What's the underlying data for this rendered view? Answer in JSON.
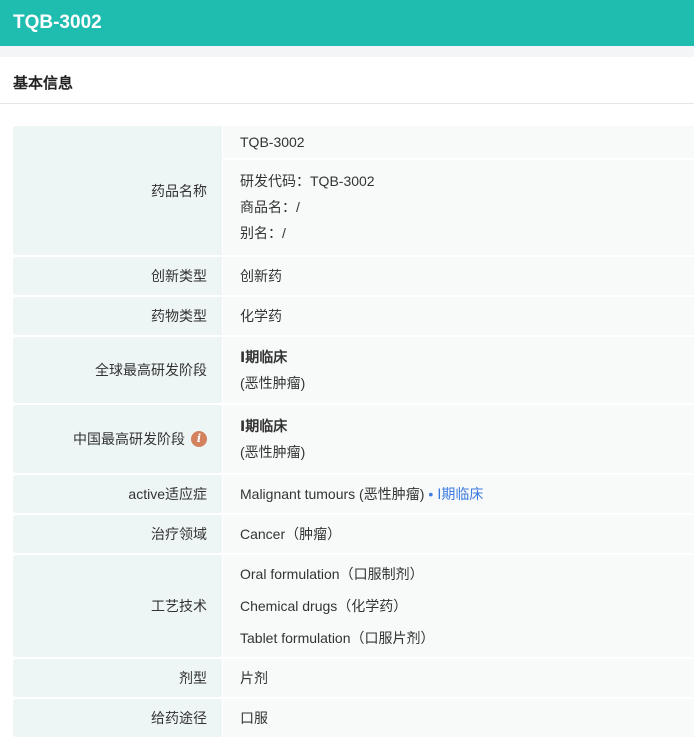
{
  "header": {
    "title": "TQB-3002"
  },
  "section": {
    "title": "基本信息"
  },
  "rows": {
    "name": {
      "label": "药品名称",
      "primary": "TQB-3002",
      "code": "研发代码：TQB-3002",
      "trade": "商品名：/",
      "alias": "别名：/"
    },
    "innovation": {
      "label": "创新类型",
      "value": "创新药"
    },
    "drug_type": {
      "label": "药物类型",
      "value": "化学药"
    },
    "global_stage": {
      "label": "全球最高研发阶段",
      "stage": "Ⅰ期临床",
      "note": "(恶性肿瘤)"
    },
    "china_stage": {
      "label": "中国最高研发阶段",
      "info_icon": "info-icon",
      "stage": "Ⅰ期临床",
      "note": "(恶性肿瘤)"
    },
    "indication": {
      "label": "active适应症",
      "value": "Malignant tumours (恶性肿瘤)",
      "stage": "Ⅰ期临床"
    },
    "therapy": {
      "label": "治疗领域",
      "value": "Cancer（肿瘤）"
    },
    "tech": {
      "label": "工艺技术",
      "values": [
        "Oral formulation（口服制剂）",
        "Chemical drugs（化学药）",
        "Tablet formulation（口服片剂）"
      ]
    },
    "form": {
      "label": "剂型",
      "value": "片剂"
    },
    "route": {
      "label": "给药途径",
      "value": "口服"
    }
  }
}
